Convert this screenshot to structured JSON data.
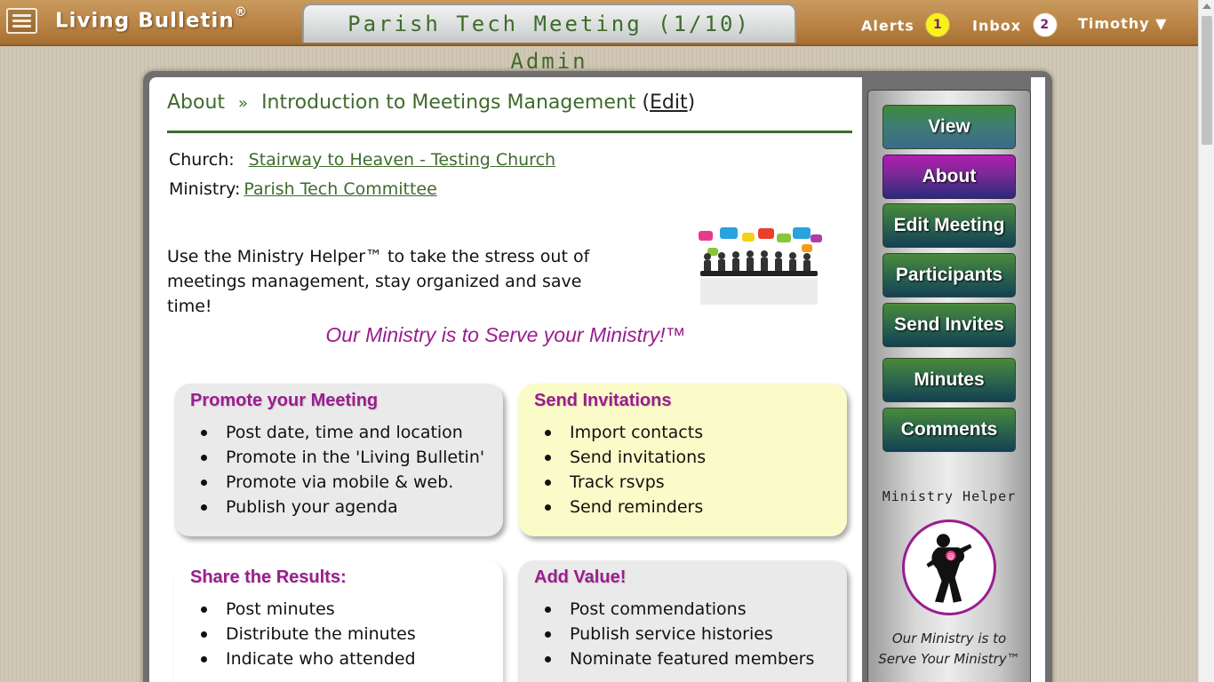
{
  "header": {
    "brand": "Living Bulletin",
    "brand_mark": "®",
    "page_title": "Parish Tech Meeting (1/10) Admin",
    "alerts_label": "Alerts",
    "alerts_count": "1",
    "inbox_label": "Inbox",
    "inbox_count": "2",
    "user_label": "Timothy ▼"
  },
  "breadcrumb": {
    "section": "About",
    "separator": "»",
    "page": "Introduction to Meetings Management",
    "edit_open": "(",
    "edit_label": "Edit",
    "edit_close": ")"
  },
  "meta": {
    "church_label": "Church:",
    "church_value": "Stairway to Heaven - Testing Church",
    "ministry_label": "Ministry:",
    "ministry_value": "Parish Tech Committee"
  },
  "intro": {
    "text": "Use the Ministry Helper™ to take the stress out of meetings management, stay organized and save time!"
  },
  "tagline": "Our Ministry is to Serve your Ministry!™",
  "cards": {
    "promote": {
      "title": "Promote your Meeting",
      "items": [
        "Post date, time and location",
        "Promote in the 'Living Bulletin'",
        "Promote via mobile & web.",
        "Publish your agenda"
      ]
    },
    "invite": {
      "title": "Send Invitations",
      "items": [
        "Import contacts",
        "Send invitations",
        "Track rsvps",
        "Send reminders"
      ]
    },
    "share": {
      "title": "Share the Results:",
      "items": [
        "Post minutes",
        "Distribute the minutes",
        "Indicate who attended"
      ]
    },
    "value": {
      "title": "Add Value!",
      "items": [
        "Post commendations",
        "Publish service histories",
        "Nominate featured members"
      ]
    }
  },
  "sidebar": {
    "buttons": {
      "view": "View",
      "about": "About",
      "edit_meeting": "Edit Meeting",
      "participants": "Participants",
      "send_invites": "Send Invites",
      "minutes": "Minutes",
      "comments": "Comments"
    },
    "helper_title": "Ministry Helper",
    "helper_caption": "Our Ministry is to Serve Your Ministry™"
  },
  "colors": {
    "accent_green": "#3f6b2c",
    "accent_magenta": "#9b1d8f",
    "badge_yellow": "#f6f21a",
    "card_yellow": "#fbfbc9",
    "card_gray": "#eaeaea"
  },
  "icons": {
    "menu": "hamburger-icon",
    "meeting_graphic": "meeting-speech-bubbles-icon",
    "helper_logo": "ministry-helper-figure-icon"
  }
}
